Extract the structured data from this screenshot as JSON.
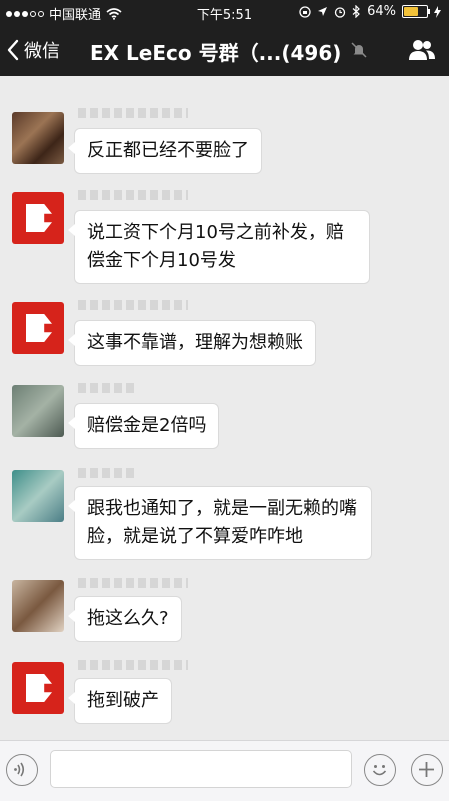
{
  "status_bar": {
    "carrier": "中国联通",
    "time": "下午5:51",
    "battery_percent": "64%",
    "battery_level": 0.64
  },
  "nav": {
    "back_label": "微信",
    "title": "EX LeEco 号群（...(496)"
  },
  "messages": [
    {
      "text": "反正都已经不要脸了",
      "avatar": "photo1"
    },
    {
      "text": "说工资下个月10号之前补发，赔偿金下个月10号发",
      "avatar": "red"
    },
    {
      "text": "这事不靠谱，理解为想赖账",
      "avatar": "red"
    },
    {
      "text": "赔偿金是2倍吗",
      "avatar": "photo2"
    },
    {
      "text": "跟我也通知了，就是一副无赖的嘴脸，就是说了不算爱咋咋地",
      "avatar": "photo3"
    },
    {
      "text": "拖这么久?",
      "avatar": "photo4"
    },
    {
      "text": "拖到破产",
      "avatar": "red"
    }
  ],
  "icons": {
    "back": "chevron-left-icon",
    "mute": "mute-bell-icon",
    "contacts": "group-contacts-icon",
    "voice": "voice-icon",
    "emoji": "emoji-icon",
    "plus": "plus-icon"
  }
}
